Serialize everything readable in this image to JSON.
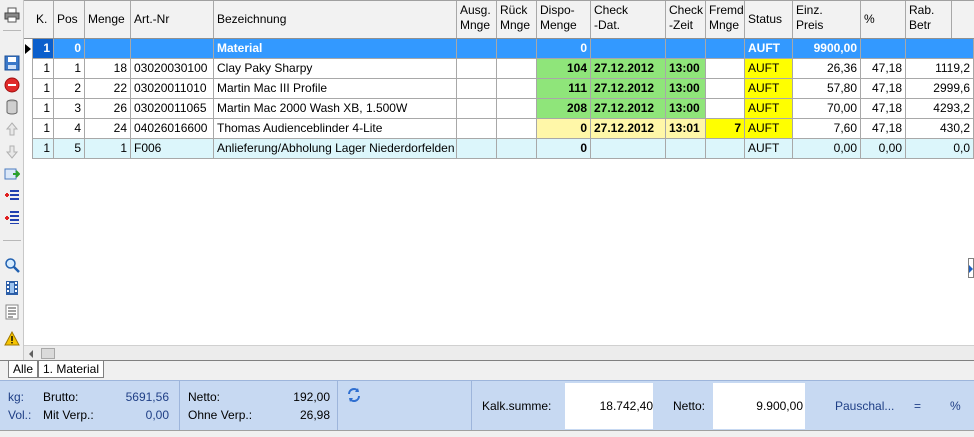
{
  "toolbar": {
    "items": [
      "print-icon",
      "save-icon",
      "delete-icon",
      "database-icon",
      "move-up-icon",
      "move-down-icon",
      "export-icon",
      "insert-row-icon",
      "insert-list-icon",
      "search-icon",
      "film-icon",
      "text-list-icon",
      "warning-icon"
    ]
  },
  "columns": [
    {
      "l1": "K.",
      "l2": ""
    },
    {
      "l1": "Pos",
      "l2": ""
    },
    {
      "l1": "Menge",
      "l2": ""
    },
    {
      "l1": "Art.-Nr",
      "l2": ""
    },
    {
      "l1": "Bezeichnung",
      "l2": ""
    },
    {
      "l1": "Ausg.",
      "l2": "Mnge"
    },
    {
      "l1": "Rück",
      "l2": "Mnge"
    },
    {
      "l1": "Dispo-",
      "l2": "Menge"
    },
    {
      "l1": "Check",
      "l2": "-Dat."
    },
    {
      "l1": "Check",
      "l2": "-Zeit"
    },
    {
      "l1": "Fremd",
      "l2": "Mnge"
    },
    {
      "l1": "Status",
      "l2": ""
    },
    {
      "l1": "Einz.",
      "l2": "Preis"
    },
    {
      "l1": "%",
      "l2": ""
    },
    {
      "l1": "Rab.",
      "l2": "Betr"
    }
  ],
  "rows": [
    {
      "k": "1",
      "pos": "0",
      "menge": "",
      "artnr": "",
      "bez": "Material",
      "ausg": "",
      "rueck": "",
      "dispo": "0",
      "cdat": "",
      "czeit": "",
      "fremd": "",
      "status": "AUFT",
      "preis": "9900,00",
      "pct": "",
      "rab": ""
    },
    {
      "k": "1",
      "pos": "1",
      "menge": "18",
      "artnr": "03020030100",
      "bez": "Clay Paky Sharpy",
      "ausg": "",
      "rueck": "",
      "dispo": "104",
      "cdat": "27.12.2012",
      "czeit": "13:00",
      "fremd": "",
      "status": "AUFT",
      "preis": "26,36",
      "pct": "47,18",
      "rab": "1119,2"
    },
    {
      "k": "1",
      "pos": "2",
      "menge": "22",
      "artnr": "03020011010",
      "bez": "Martin Mac III Profile",
      "ausg": "",
      "rueck": "",
      "dispo": "111",
      "cdat": "27.12.2012",
      "czeit": "13:00",
      "fremd": "",
      "status": "AUFT",
      "preis": "57,80",
      "pct": "47,18",
      "rab": "2999,6"
    },
    {
      "k": "1",
      "pos": "3",
      "menge": "26",
      "artnr": "03020011065",
      "bez": "Martin Mac 2000 Wash XB, 1.500W",
      "ausg": "",
      "rueck": "",
      "dispo": "208",
      "cdat": "27.12.2012",
      "czeit": "13:00",
      "fremd": "",
      "status": "AUFT",
      "preis": "70,00",
      "pct": "47,18",
      "rab": "4293,2"
    },
    {
      "k": "1",
      "pos": "4",
      "menge": "24",
      "artnr": "04026016600",
      "bez": "Thomas Audienceblinder 4-Lite",
      "ausg": "",
      "rueck": "",
      "dispo": "0",
      "cdat": "27.12.2012",
      "czeit": "13:01",
      "fremd": "7",
      "status": "AUFT",
      "preis": "7,60",
      "pct": "47,18",
      "rab": "430,2"
    },
    {
      "k": "1",
      "pos": "5",
      "menge": "1",
      "artnr": "F006",
      "bez": "Anlieferung/Abholung Lager Niederdorfelden",
      "ausg": "",
      "rueck": "",
      "dispo": "0",
      "cdat": "",
      "czeit": "",
      "fremd": "",
      "status": "AUFT",
      "preis": "0,00",
      "pct": "0,00",
      "rab": "0,0"
    }
  ],
  "tabs": [
    "Alle",
    "1. Material"
  ],
  "footer": {
    "kg_label": "kg:",
    "vol_label": "Vol.:",
    "brutto_label": "Brutto:",
    "brutto_value": "5691,56",
    "mitverp_label": "Mit Verp.:",
    "mitverp_value": "0,00",
    "netto1_label": "Netto:",
    "netto1_value": "192,00",
    "ohneverp_label": "Ohne Verp.:",
    "ohneverp_value": "26,98",
    "kalk_label": "Kalk.summe:",
    "kalk_value": "18.742,40",
    "netto2_label": "Netto:",
    "netto2_value": "9.900,00",
    "pauschal_label": "Pauschal...",
    "equals": "=",
    "percent": "%"
  },
  "colors": {
    "selection": "#3399ff",
    "dispo_green": "#8fe57a",
    "status_yellow": "#ffff00",
    "light_yellow": "#fff7a8",
    "footer_bg": "#c7d9f2"
  }
}
